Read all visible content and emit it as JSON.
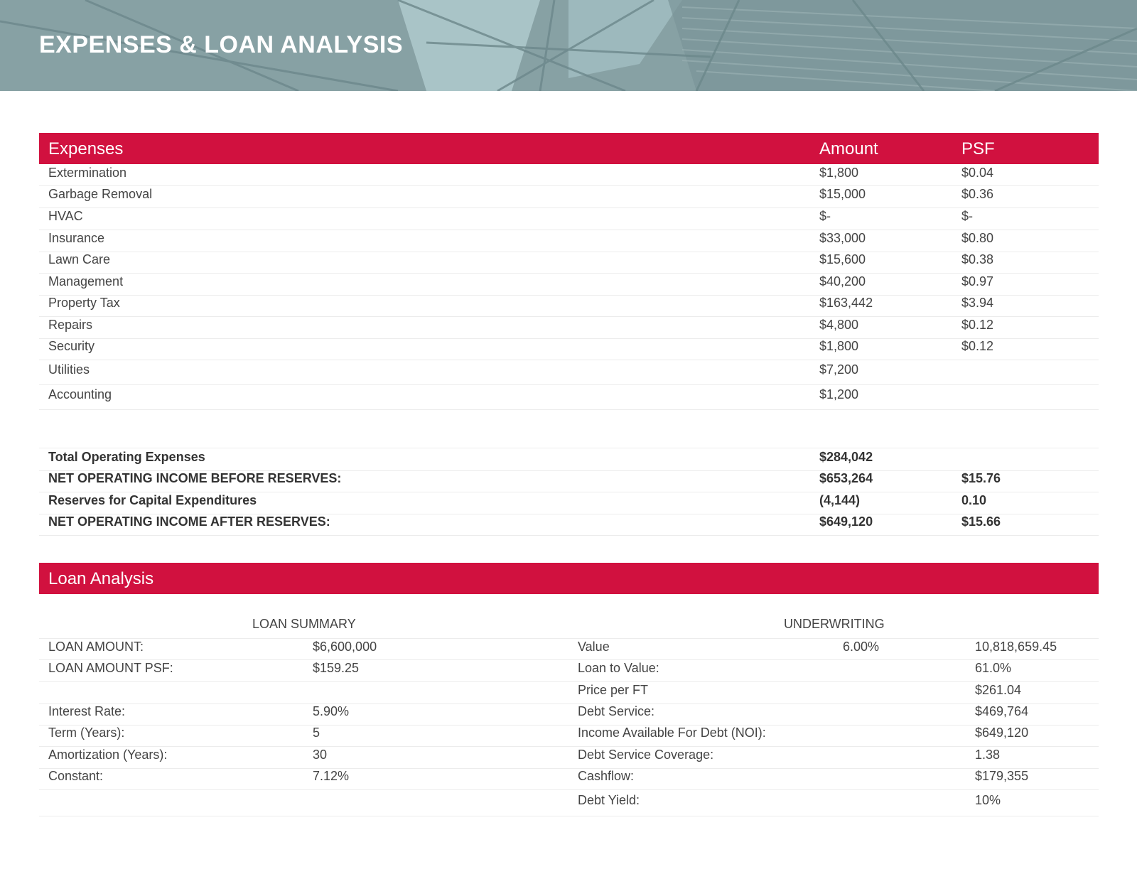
{
  "title": "EXPENSES & LOAN ANALYSIS",
  "colors": {
    "accent": "#d1113f",
    "banner": "#8ea6aa"
  },
  "expenses": {
    "headers": {
      "name": "Expenses",
      "amount": "Amount",
      "psf": "PSF"
    },
    "rows": [
      {
        "name": "Extermination",
        "amount": "$1,800",
        "psf": "$0.04"
      },
      {
        "name": "Garbage Removal",
        "amount": "$15,000",
        "psf": "$0.36"
      },
      {
        "name": "HVAC",
        "amount": "$-",
        "psf": "$-"
      },
      {
        "name": "Insurance",
        "amount": "$33,000",
        "psf": "$0.80"
      },
      {
        "name": "Lawn Care",
        "amount": "$15,600",
        "psf": "$0.38"
      },
      {
        "name": "Management",
        "amount": "$40,200",
        "psf": "$0.97"
      },
      {
        "name": "Property Tax",
        "amount": "$163,442",
        "psf": "$3.94"
      },
      {
        "name": "Repairs",
        "amount": "$4,800",
        "psf": "$0.12"
      },
      {
        "name": "Security",
        "amount": "$1,800",
        "psf": "$0.12"
      },
      {
        "name": "Utilities",
        "amount": "$7,200",
        "psf": ""
      },
      {
        "name": "Accounting",
        "amount": "$1,200",
        "psf": ""
      }
    ],
    "totals": [
      {
        "name": "Total Operating Expenses",
        "amount": "$284,042",
        "psf": ""
      },
      {
        "name": "NET OPERATING INCOME BEFORE RESERVES:",
        "amount": "$653,264",
        "psf": "$15.76"
      },
      {
        "name": "Reserves for Capital Expenditures",
        "amount": "(4,144)",
        "psf": "0.10"
      },
      {
        "name": "NET OPERATING INCOME AFTER RESERVES:",
        "amount": "$649,120",
        "psf": "$15.66"
      }
    ]
  },
  "loan": {
    "header": "Loan Analysis",
    "summary_title": "LOAN SUMMARY",
    "underwriting_title": "UNDERWRITING",
    "rows": [
      {
        "label": "LOAN AMOUNT:",
        "value": "$6,600,000",
        "uw_label": "Value",
        "uw_mid": "6.00%",
        "uw_value": "10,818,659.45"
      },
      {
        "label": "LOAN AMOUNT PSF:",
        "value": "$159.25",
        "uw_label": "Loan to Value:",
        "uw_mid": "",
        "uw_value": "61.0%"
      },
      {
        "label": "",
        "value": "",
        "uw_label": "Price per FT",
        "uw_mid": "",
        "uw_value": "$261.04"
      },
      {
        "label": "Interest Rate:",
        "value": "5.90%",
        "uw_label": "Debt Service:",
        "uw_mid": "",
        "uw_value": "$469,764"
      },
      {
        "label": "Term (Years):",
        "value": "5",
        "uw_label": "Income Available For Debt (NOI):",
        "uw_mid": "",
        "uw_value": "$649,120"
      },
      {
        "label": "Amortization (Years):",
        "value": "30",
        "uw_label": "Debt Service Coverage:",
        "uw_mid": "",
        "uw_value": "1.38"
      },
      {
        "label": "Constant:",
        "value": "7.12%",
        "uw_label": "Cashflow:",
        "uw_mid": "",
        "uw_value": "$179,355"
      },
      {
        "label": "",
        "value": "",
        "uw_label": "Debt Yield:",
        "uw_mid": "",
        "uw_value": "10%"
      }
    ]
  }
}
